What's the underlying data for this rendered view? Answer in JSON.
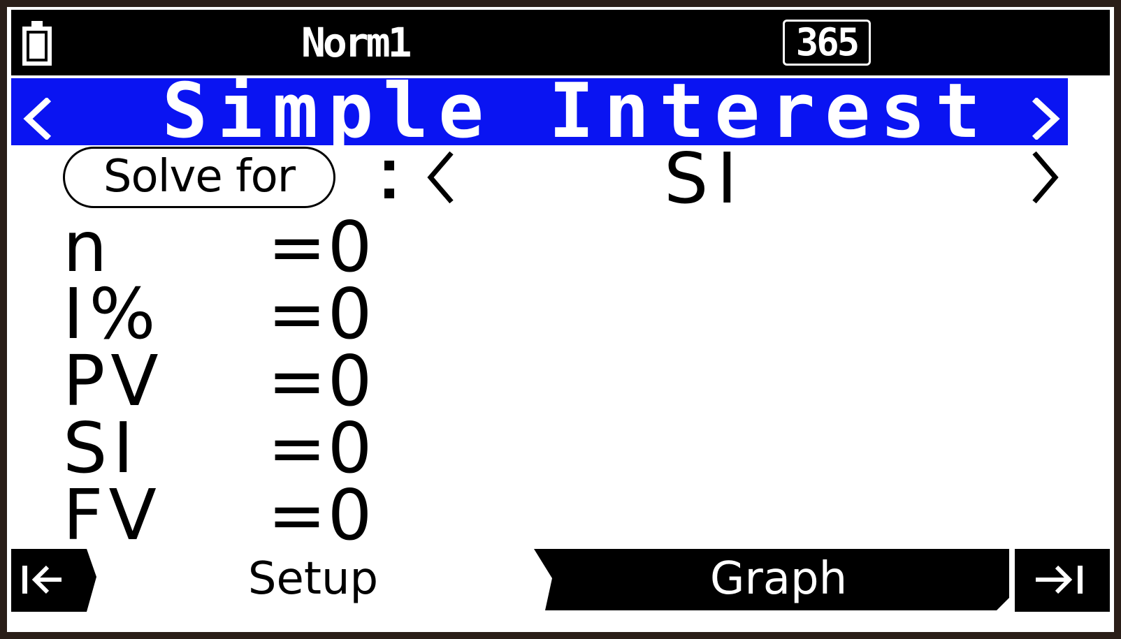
{
  "status": {
    "mode": "Norm1",
    "badge": "365",
    "battery_icon": "battery-icon"
  },
  "title": {
    "text": "Simple Interest",
    "left_arrow": "<",
    "right_arrow": ">"
  },
  "solve": {
    "label": "Solve for",
    "colon": ":",
    "value": "SI"
  },
  "variables": [
    {
      "name": "n",
      "eq": "=0"
    },
    {
      "name": "I%",
      "eq": "=0"
    },
    {
      "name": "PV",
      "eq": "=0"
    },
    {
      "name": "SI",
      "eq": "=0"
    },
    {
      "name": "FV",
      "eq": "=0"
    }
  ],
  "softkeys": {
    "setup": "Setup",
    "graph": "Graph"
  },
  "colors": {
    "title_bg": "#0a14f2",
    "bar_bg": "#000000",
    "screen_bg": "#ffffff"
  }
}
